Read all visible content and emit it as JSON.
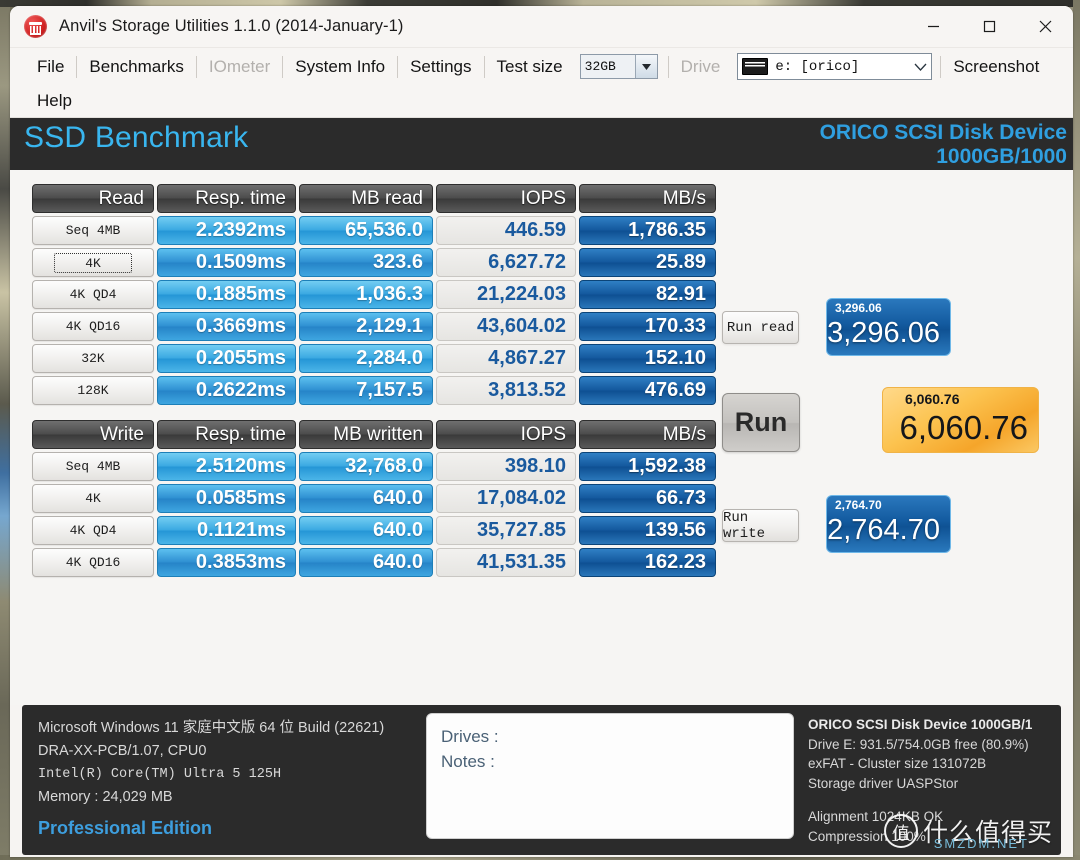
{
  "window": {
    "title": "Anvil's Storage Utilities 1.1.0 (2014-January-1)",
    "icon": "anvil-icon",
    "minimize_label": "minimize-icon",
    "maximize_label": "maximize-icon",
    "close_label": "close-icon"
  },
  "menu": {
    "row1": [
      {
        "label": "File",
        "disabled": false
      },
      {
        "label": "Benchmarks",
        "disabled": false
      },
      {
        "label": "IOmeter",
        "disabled": true
      },
      {
        "label": "System Info",
        "disabled": false
      },
      {
        "label": "Settings",
        "disabled": false
      }
    ],
    "test_size_label": "Test size",
    "test_size_value": "32GB",
    "drive_label": "Drive",
    "drive_value": "e: [orico]",
    "screenshot_label": "Screenshot",
    "row2": [
      {
        "label": "Help",
        "disabled": false
      }
    ]
  },
  "bench_header": {
    "title": "SSD Benchmark",
    "device_line1": "ORICO  SCSI Disk Device",
    "device_line2": "1000GB/1000"
  },
  "read_table": {
    "headers": [
      "Read",
      "Resp. time",
      "MB read",
      "IOPS",
      "MB/s"
    ],
    "rows": [
      {
        "label": "Seq 4MB",
        "resp": "2.2392ms",
        "mb": "65,536.0",
        "iops": "446.59",
        "mbs": "1,786.35",
        "focused": false
      },
      {
        "label": "4K",
        "resp": "0.1509ms",
        "mb": "323.6",
        "iops": "6,627.72",
        "mbs": "25.89",
        "focused": true
      },
      {
        "label": "4K QD4",
        "resp": "0.1885ms",
        "mb": "1,036.3",
        "iops": "21,224.03",
        "mbs": "82.91",
        "focused": false
      },
      {
        "label": "4K QD16",
        "resp": "0.3669ms",
        "mb": "2,129.1",
        "iops": "43,604.02",
        "mbs": "170.33",
        "focused": false
      },
      {
        "label": "32K",
        "resp": "0.2055ms",
        "mb": "2,284.0",
        "iops": "4,867.27",
        "mbs": "152.10",
        "focused": false
      },
      {
        "label": "128K",
        "resp": "0.2622ms",
        "mb": "7,157.5",
        "iops": "3,813.52",
        "mbs": "476.69",
        "focused": false
      }
    ]
  },
  "write_table": {
    "headers": [
      "Write",
      "Resp. time",
      "MB written",
      "IOPS",
      "MB/s"
    ],
    "rows": [
      {
        "label": "Seq 4MB",
        "resp": "2.5120ms",
        "mb": "32,768.0",
        "iops": "398.10",
        "mbs": "1,592.38",
        "focused": false
      },
      {
        "label": "4K",
        "resp": "0.0585ms",
        "mb": "640.0",
        "iops": "17,084.02",
        "mbs": "66.73",
        "focused": false
      },
      {
        "label": "4K QD4",
        "resp": "0.1121ms",
        "mb": "640.0",
        "iops": "35,727.85",
        "mbs": "139.56",
        "focused": false
      },
      {
        "label": "4K QD16",
        "resp": "0.3853ms",
        "mb": "640.0",
        "iops": "41,531.35",
        "mbs": "162.23",
        "focused": false
      }
    ]
  },
  "actions": {
    "run_read": "Run read",
    "run": "Run",
    "run_write": "Run write"
  },
  "scores": {
    "read": {
      "value": "3,296.06",
      "label": "3,296.06"
    },
    "total": {
      "value": "6,060.76",
      "label": "6,060.76"
    },
    "write": {
      "value": "2,764.70",
      "label": "2,764.70"
    }
  },
  "system_info": {
    "os": "Microsoft Windows 11 家庭中文版 64 位 Build (22621)",
    "board": "DRA-XX-PCB/1.07, CPU0",
    "cpu": "Intel(R) Core(TM) Ultra 5 125H",
    "memory": "Memory : 24,029 MB",
    "edition": "Professional Edition"
  },
  "notes_box": {
    "drives_label": "Drives :",
    "notes_label": "Notes :"
  },
  "drive_info": {
    "line1": "ORICO  SCSI Disk Device 1000GB/1",
    "line2": "Drive E: 931.5/754.0GB free (80.9%)",
    "line3": "exFAT - Cluster size 131072B",
    "line4": "Storage driver  UASPStor",
    "line5": "Alignment 1024KB OK",
    "line6": "Compression 100%"
  },
  "watermark": {
    "badge": "值",
    "text": "什么值得买",
    "sub": "SMZDM.NET"
  },
  "colors": {
    "accent_blue": "#2f9fe0",
    "title_blue": "#39b6ef",
    "cell_light_blue": "#3ba9e2",
    "cell_dark_blue": "#14599e",
    "iops_text": "#1a5a9e",
    "total_orange": "#f5a52a",
    "panel_dark": "#2b2b2b"
  }
}
